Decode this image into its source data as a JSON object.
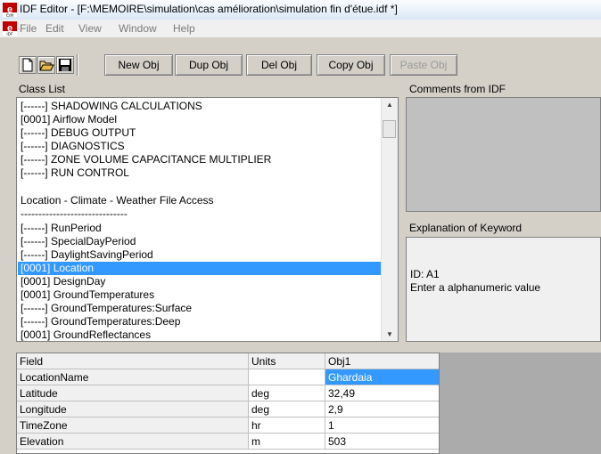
{
  "window": {
    "title": "IDF Editor - [F:\\MEMOIRE\\simulation\\cas amélioration\\simulation fin d'étue.idf *]"
  },
  "menu": {
    "items": [
      "File",
      "Edit",
      "View",
      "Window",
      "Help"
    ]
  },
  "toolbar": {
    "new_obj": "New Obj",
    "dup_obj": "Dup Obj",
    "del_obj": "Del Obj",
    "copy_obj": "Copy Obj",
    "paste_obj": "Paste Obj"
  },
  "labels": {
    "class_list": "Class List",
    "comments": "Comments from IDF",
    "explanation": "Explanation of Keyword"
  },
  "class_list": {
    "items": [
      "[------]  SHADOWING CALCULATIONS",
      "[0001]  Airflow Model",
      "[------]  DEBUG OUTPUT",
      "[------]  DIAGNOSTICS",
      "[------]  ZONE VOLUME CAPACITANCE MULTIPLIER",
      "[------]  RUN CONTROL",
      "",
      "Location - Climate - Weather File Access",
      "------------------------------",
      "[------]  RunPeriod",
      "[------]  SpecialDayPeriod",
      "[------]  DaylightSavingPeriod",
      "[0001]  Location",
      "[0001]  DesignDay",
      "[0001]  GroundTemperatures",
      "[------]  GroundTemperatures:Surface",
      "[------]  GroundTemperatures:Deep",
      "[0001]  GroundReflectances"
    ],
    "selected": "[0001]  Location"
  },
  "explanation": {
    "id": "ID: A1",
    "text": "Enter a alphanumeric value"
  },
  "grid": {
    "headers": [
      "Field",
      "Units",
      "Obj1"
    ],
    "rows": [
      {
        "field": "LocationName",
        "units": "",
        "value": "Ghardaia"
      },
      {
        "field": "Latitude",
        "units": "deg",
        "value": "32,49"
      },
      {
        "field": "Longitude",
        "units": "deg",
        "value": "2,9"
      },
      {
        "field": "TimeZone",
        "units": "hr",
        "value": "1"
      },
      {
        "field": "Elevation",
        "units": "m",
        "value": "503"
      }
    ]
  }
}
